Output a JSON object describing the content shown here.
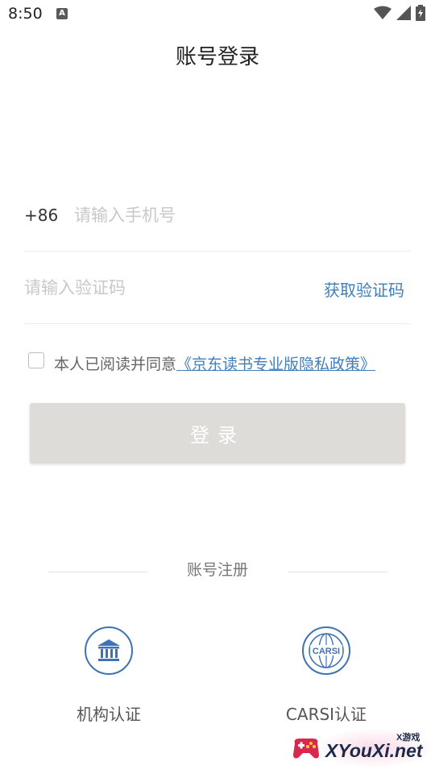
{
  "status_bar": {
    "time": "8:50",
    "notification_icon": "a-letter-icon",
    "icons": [
      "wifi-icon",
      "signal-icon",
      "battery-charging-icon"
    ]
  },
  "header": {
    "title": "账号登录"
  },
  "phone": {
    "country_code": "+86",
    "placeholder": "请输入手机号",
    "value": ""
  },
  "verification": {
    "placeholder": "请输入验证码",
    "value": "",
    "get_code_label": "获取验证码"
  },
  "agreement": {
    "checked": false,
    "text": "本人已阅读并同意",
    "policy_link": "《京东读书专业版隐私政策》"
  },
  "login_button": {
    "label": "登录"
  },
  "register": {
    "label": "账号注册"
  },
  "auth_options": [
    {
      "label": "机构认证",
      "icon": "institution-icon"
    },
    {
      "label": "CARSI认证",
      "icon": "carsi-globe-icon"
    }
  ],
  "watermark": {
    "main_text": "XYouXi.net",
    "top_text": "X游戏"
  },
  "colors": {
    "accent": "#3f7fbd",
    "icon_blue": "#3f72b5",
    "button_disabled": "#dedcd8",
    "placeholder": "#c8c8c8"
  }
}
